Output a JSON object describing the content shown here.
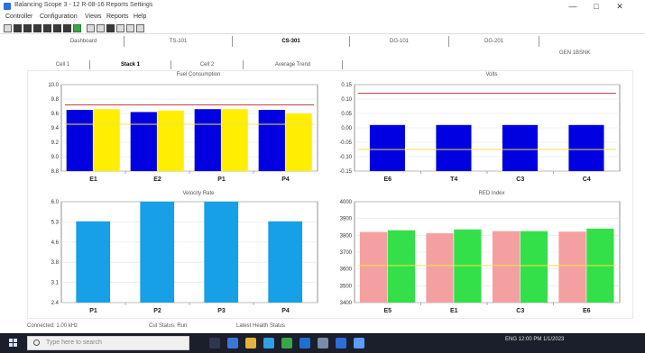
{
  "window": {
    "title": "Balancing Scope 3 - 12 R-08-16 Reports Settings",
    "minimize_glyph": "—",
    "maximize_glyph": "□",
    "close_glyph": "✕"
  },
  "menu": [
    "Controller",
    "Configuration",
    "Views",
    "Reports",
    "Help"
  ],
  "header_tabs": [
    {
      "label": "Dashboard",
      "active": false
    },
    {
      "label": "TS-101",
      "active": false
    },
    {
      "label": "CS-301",
      "active": true
    },
    {
      "label": "DG-101",
      "active": false
    },
    {
      "label": "DG-201",
      "active": false
    }
  ],
  "side_label": "GEN 1BSNK",
  "sub_tabs": [
    {
      "label": "Cell 1",
      "active": false
    },
    {
      "label": "Stack 1",
      "active": true
    },
    {
      "label": "Cell 2",
      "active": false
    },
    {
      "label": "Average Trend",
      "active": false
    }
  ],
  "status": {
    "left": "Connected: 1.00 kHz",
    "middle": "Cut Status: Run",
    "right": "Latest Health Status"
  },
  "taskbar": {
    "search_placeholder": "Type here to search",
    "tray_text": "ENG  12:00 PM  1/1/2023"
  },
  "charts": {
    "top_left": {
      "title": "Fuel Consumption",
      "categories": [
        "E1",
        "E2",
        "P1",
        "P4"
      ],
      "yticks": [
        "10.0",
        "9.8",
        "9.6",
        "9.4",
        "9.2",
        "9.0",
        "8.8"
      ],
      "ylim": [
        8.8,
        10.0
      ],
      "series": [
        {
          "values": [
            9.65,
            9.62,
            9.66,
            9.65
          ]
        },
        {
          "values": [
            9.66,
            9.64,
            9.66,
            9.6
          ]
        }
      ],
      "colors": [
        "#0000e0",
        "#ffee00"
      ],
      "ref_line_top": 9.72,
      "ref_line_mid": 9.45
    },
    "top_right": {
      "title": "Volts",
      "categories": [
        "E6",
        "T4",
        "C3",
        "C4"
      ],
      "yticks": [
        "0.15",
        "0.10",
        "0.05",
        "0.00",
        "-0.05",
        "-0.10",
        "-0.15"
      ],
      "ylim": [
        -0.15,
        0.15
      ],
      "values": [
        0.01,
        0.01,
        0.01,
        0.01
      ],
      "bar_color": "#0000e0",
      "ref_line_top": 0.12,
      "ref_line_mid": -0.075
    },
    "bottom_left": {
      "title": "Velocity Rate",
      "categories": [
        "P1",
        "P2",
        "P3",
        "P4"
      ],
      "yticks": [
        "6.0",
        "5.3",
        "4.6",
        "3.8",
        "3.1",
        "2.4"
      ],
      "ylim": [
        2.4,
        6.0
      ],
      "values": [
        5.3,
        6.0,
        6.0,
        5.3
      ],
      "bar_color": "#17a0e6"
    },
    "bottom_right": {
      "title": "RED Index",
      "categories": [
        "E5",
        "E1",
        "C3",
        "E6"
      ],
      "yticks": [
        "4000",
        "3900",
        "3800",
        "3700",
        "3600",
        "3500",
        "3400"
      ],
      "ylim": [
        3400,
        4000
      ],
      "series": [
        {
          "values": [
            3820,
            3812,
            3825,
            3822
          ]
        },
        {
          "values": [
            3830,
            3835,
            3825,
            3840
          ]
        }
      ],
      "colors": [
        "#f4a0a0",
        "#33e04a"
      ],
      "ref_line_mid": 3620
    }
  }
}
